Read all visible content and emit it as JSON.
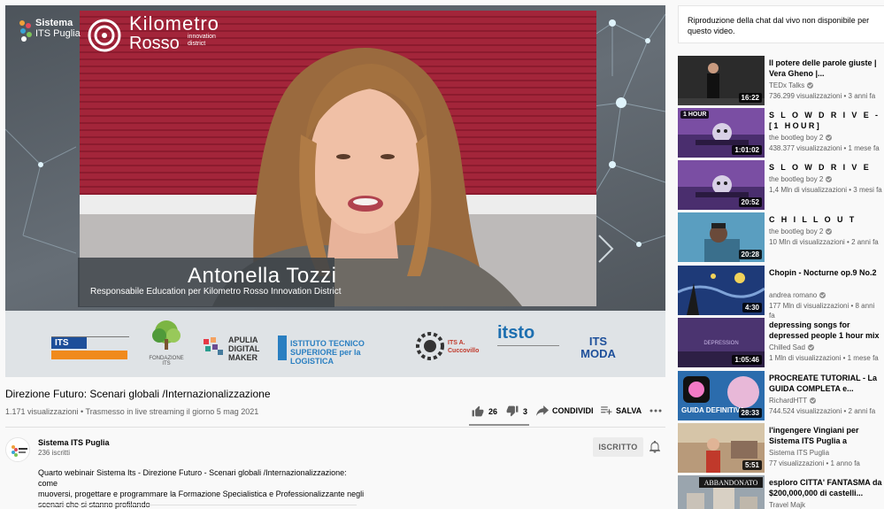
{
  "video": {
    "overlay": {
      "brand_logo_line1": "Kilometro",
      "brand_logo_line2": "Rosso",
      "brand_logo_sub1": "innovation",
      "brand_logo_sub2": "district",
      "sistema_line1": "Sistema",
      "sistema_line2": "ITS Puglia",
      "speaker_name": "Antonella Tozzi",
      "speaker_role": "Responsabile Education per Kilometro Rosso Innovation District"
    },
    "sponsors": [
      {
        "label": "ITS"
      },
      {
        "label": "FONDAZIONE ITS"
      },
      {
        "label": "APULIA DIGITAL MAKER"
      },
      {
        "label": "ISTITUTO TECNICO SUPERIORE per la LOGISTICA"
      },
      {
        "label": "ITS A. Cuccovillo"
      },
      {
        "label": "itsto"
      },
      {
        "label": "ITS MODA"
      }
    ],
    "title": "Direzione Futuro: Scenari globali /Internazionalizzazione",
    "meta": "1.171 visualizzazioni • Trasmesso in live streaming il giorno 5 mag 2021",
    "likes": "26",
    "dislikes": "3",
    "share_label": "CONDIVIDI",
    "save_label": "SALVA"
  },
  "channel": {
    "name": "Sistema ITS Puglia",
    "subscribers": "236 iscritti",
    "subscribed_label": "ISCRITTO",
    "description_lines": [
      "Quarto webinair Sistema Its - Direzione Futuro - Scenari globali /Internazionalizzazione: come",
      "muoversi, progettare e programmare la Formazione Specialistica e Professionalizzante negli",
      "scenari che si stanno profilando"
    ]
  },
  "chat_notice": "Riproduzione della chat dal vivo non disponibile per questo video.",
  "recommendations": [
    {
      "title": "Il potere delle parole giuste | Vera Gheno |...",
      "channel": "TEDx Talks",
      "verified": true,
      "views": "736.299 visualizzazioni • 3 anni fa",
      "duration": "16:22",
      "badge": "",
      "thumb_color": "#2a2a2a"
    },
    {
      "title": "S L O W   D R I V E - [1 HOUR]",
      "channel": "the bootleg boy 2",
      "verified": true,
      "views": "438.377 visualizzazioni • 1 mese fa",
      "duration": "1:01:02",
      "badge": "1 HOUR",
      "thumb_color": "#6b3f8f"
    },
    {
      "title": "S L O W   D R I V E",
      "channel": "the bootleg boy 2",
      "verified": true,
      "views": "1,4 Mln di visualizzazioni • 3 mesi fa",
      "duration": "20:52",
      "badge": "",
      "thumb_color": "#6e4496"
    },
    {
      "title": "C H I L L O U T",
      "channel": "the bootleg boy 2",
      "verified": true,
      "views": "10 Mln di visualizzazioni • 2 anni fa",
      "duration": "20:28",
      "badge": "",
      "thumb_color": "#4b88a8"
    },
    {
      "title": "Chopin - Nocturne op.9 No.2",
      "channel": "andrea romano",
      "verified": true,
      "views": "177 Mln di visualizzazioni • 8 anni fa",
      "duration": "4:30",
      "badge": "",
      "thumb_color": "#1e3a78"
    },
    {
      "title": "depressing songs for depressed people 1 hour mix ...",
      "channel": "Chilled Sad",
      "verified": true,
      "views": "1 Mln di visualizzazioni • 1 mese fa",
      "duration": "1:05:46",
      "badge": "",
      "thumb_color": "#5a3f80"
    },
    {
      "title": "PROCREATE TUTORIAL - La GUIDA COMPLETA e...",
      "channel": "RichardHTT",
      "verified": true,
      "views": "744.524 visualizzazioni • 2 anni fa",
      "duration": "28:33",
      "badge": "",
      "thumb_color": "#2e6fb0"
    },
    {
      "title": "l'ingengere Vingiani per Sistema ITS Puglia a Mattino...",
      "channel": "Sistema ITS Puglia",
      "verified": false,
      "views": "77 visualizzazioni • 1 anno fa",
      "duration": "5:51",
      "badge": "",
      "thumb_color": "#8a6d5a"
    },
    {
      "title": "esploro CITTA' FANTASMA da $200,000,000 di castelli...",
      "channel": "Travel Majk",
      "verified": false,
      "views": "",
      "duration": "",
      "badge": "",
      "thumb_color": "#7d8790"
    }
  ],
  "thumb_texts": {
    "procreate": "GUIDA DEFINITIVA",
    "abandoned": "ABBANDONATO",
    "depression": "DEPRESSION"
  }
}
